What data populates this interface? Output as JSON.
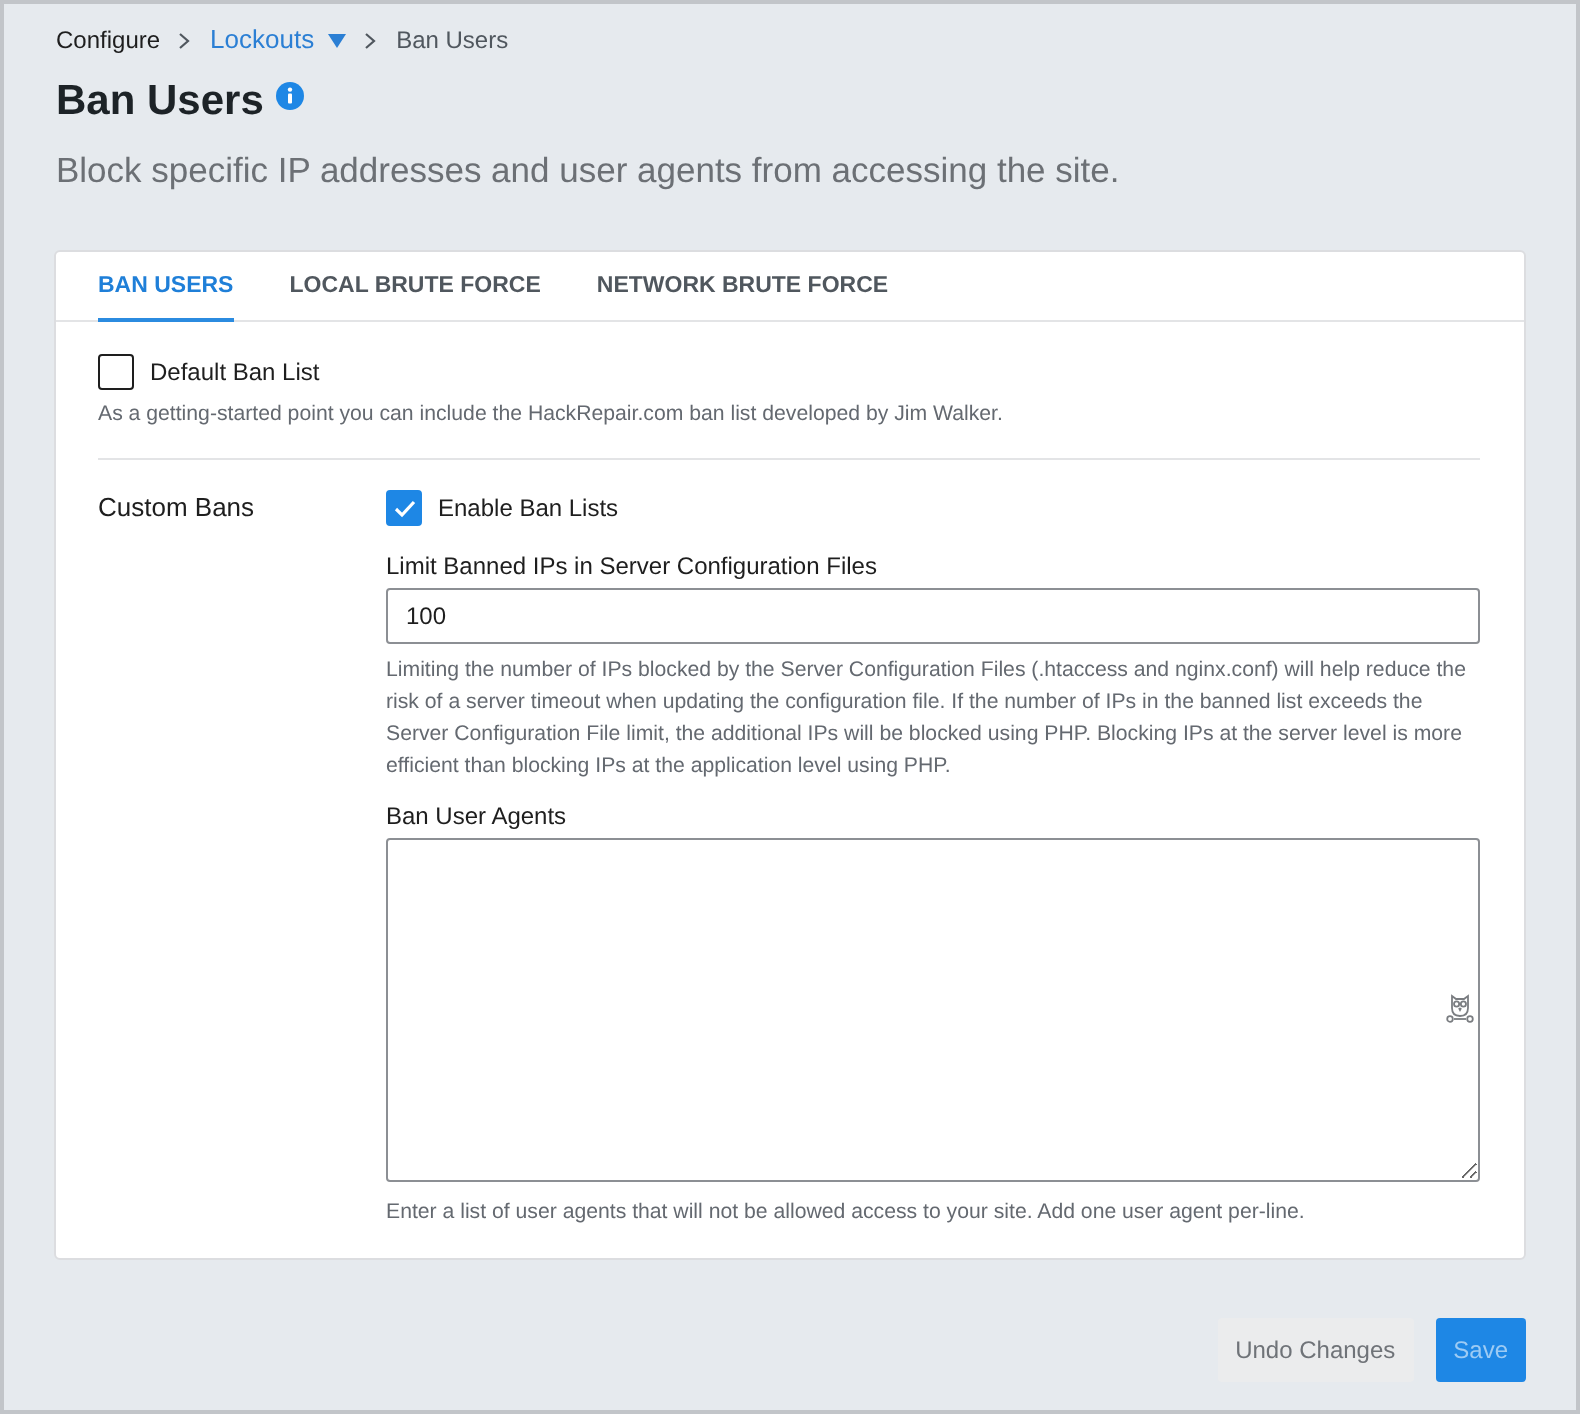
{
  "breadcrumb": [
    {
      "label": "Configure",
      "kind": "link"
    },
    {
      "label": "Lockouts",
      "kind": "dropdown"
    },
    {
      "label": "Ban Users",
      "kind": "current"
    }
  ],
  "page": {
    "title": "Ban Users",
    "subtitle": "Block specific IP addresses and user agents from accessing the site."
  },
  "tabs": [
    {
      "label": "BAN USERS",
      "selected": true
    },
    {
      "label": "LOCAL BRUTE FORCE",
      "selected": false
    },
    {
      "label": "NETWORK BRUTE FORCE",
      "selected": false
    }
  ],
  "default_ban_list": {
    "label": "Default Ban List",
    "checked": false,
    "description": "As a getting-started point you can include the HackRepair.com ban list developed by Jim Walker."
  },
  "custom_bans": {
    "label": "Custom Bans",
    "enable_ban_lists": {
      "label": "Enable Ban Lists",
      "checked": true
    },
    "limit_field": {
      "label": "Limit Banned IPs in Server Configuration Files",
      "value": "100",
      "description": "Limiting the number of IPs blocked by the Server Configuration Files (.htaccess and nginx.conf) will help reduce the risk of a server timeout when updating the configuration file. If the number of IPs in the banned list exceeds the Server Configuration File limit, the additional IPs will be blocked using PHP. Blocking IPs at the server level is more efficient than blocking IPs at the application level using PHP."
    },
    "user_agents_field": {
      "label": "Ban User Agents",
      "description": "Enter a list of user agents that will not be allowed access to your site. Add one user agent per-line."
    }
  },
  "buttons": [
    {
      "label": "Undo Changes",
      "kind": "secondary",
      "disabled": true
    },
    {
      "label": "Save",
      "kind": "primary",
      "disabled": true
    }
  ]
}
